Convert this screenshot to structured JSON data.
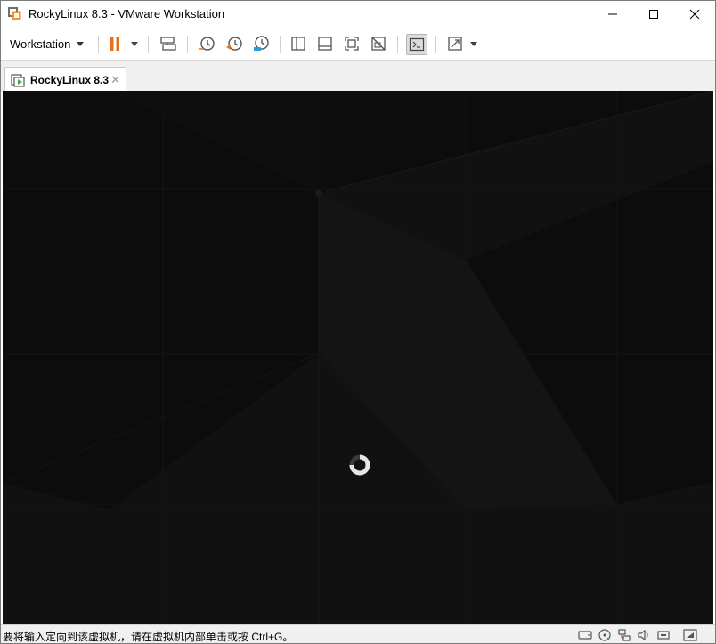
{
  "window": {
    "title": "RockyLinux 8.3 - VMware Workstation"
  },
  "toolbar": {
    "menu_label": "Workstation",
    "icons": [
      "pause-icon",
      "send-keys-icon",
      "snapshot-icon",
      "revert-snapshot-icon",
      "snapshot-manager-icon",
      "sidebar-icon",
      "thumbnail-icon",
      "fullscreen-icon",
      "unity-icon",
      "console-icon",
      "stretch-icon"
    ],
    "accent_color": "#e8721c"
  },
  "tabs": [
    {
      "label": "RockyLinux 8.3",
      "close": "✕"
    }
  ],
  "vm": {
    "background_color": "#0b0b0b",
    "state": "loading"
  },
  "statusbar": {
    "message": "要将输入定向到该虚拟机，请在虚拟机内部单击或按 Ctrl+G。",
    "device_icons": [
      "hard-disk-icon",
      "cd-dvd-icon",
      "network-icon",
      "sound-icon",
      "usb-icon",
      "message-icon"
    ]
  }
}
